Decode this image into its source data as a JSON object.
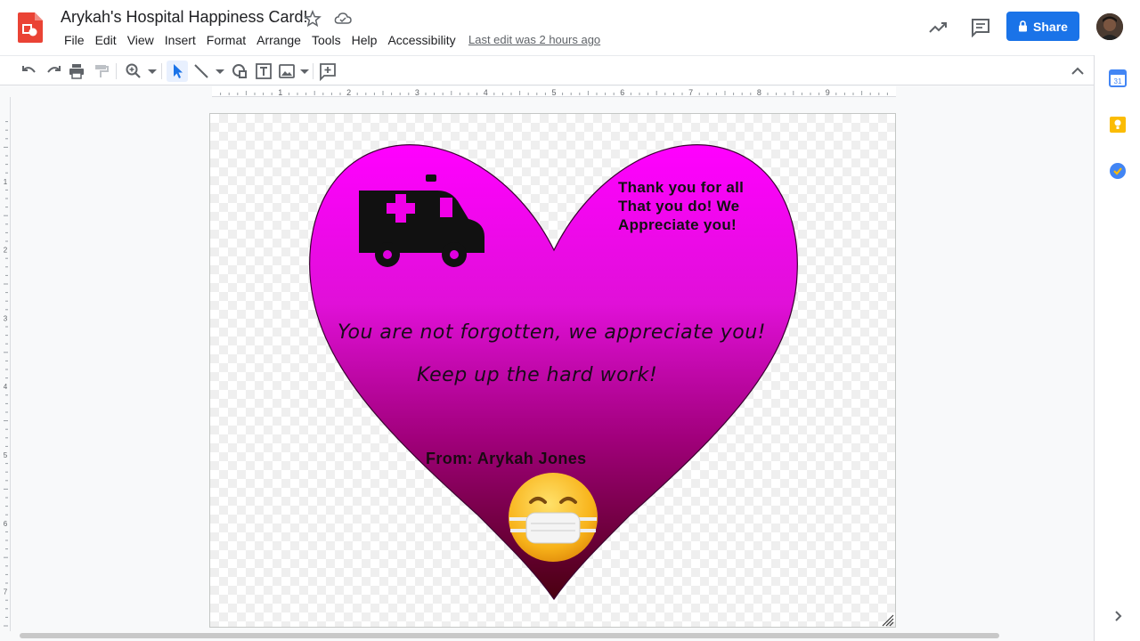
{
  "doc": {
    "title": "Arykah's Hospital Happiness Card!",
    "last_edit": "Last edit was 2 hours ago"
  },
  "menu": [
    "File",
    "Edit",
    "View",
    "Insert",
    "Format",
    "Arrange",
    "Tools",
    "Help",
    "Accessibility"
  ],
  "share": {
    "label": "Share"
  },
  "ruler": {
    "h_marks": [
      "1",
      "2",
      "3",
      "4",
      "5",
      "6",
      "7",
      "8",
      "9"
    ],
    "v_marks": [
      "1",
      "2",
      "3",
      "4",
      "5",
      "6",
      "7"
    ]
  },
  "card": {
    "thanks_lines": [
      "Thank you for all",
      "That you do! We",
      "Appreciate you!"
    ],
    "message_line1": "You are not forgotten, we appreciate you!",
    "message_line2": "Keep up the hard work!",
    "from": "From: Arykah Jones"
  },
  "colors": {
    "heart_top": "#ff00ff",
    "heart_bottom": "#5a0018",
    "share_blue": "#1a73e8",
    "app_red": "#ea4335"
  },
  "icons": [
    "undo-icon",
    "redo-icon",
    "print-icon",
    "paint-format-icon",
    "zoom-icon",
    "select-icon",
    "line-icon",
    "shape-icon",
    "textbox-icon",
    "image-icon",
    "comment-add-icon"
  ]
}
